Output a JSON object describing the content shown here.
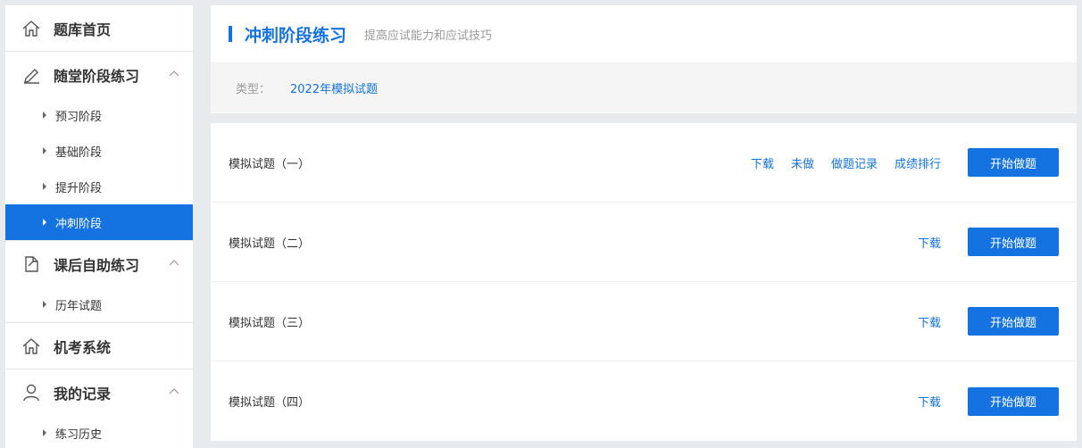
{
  "sidebar": {
    "home": {
      "label": "题库首页"
    },
    "practice": {
      "label": "随堂阶段练习",
      "items": [
        {
          "label": "预习阶段"
        },
        {
          "label": "基础阶段"
        },
        {
          "label": "提升阶段"
        },
        {
          "label": "冲刺阶段"
        }
      ]
    },
    "self_practice": {
      "label": "课后自助练习",
      "items": [
        {
          "label": "历年试题"
        }
      ]
    },
    "exam_system": {
      "label": "机考系统"
    },
    "records": {
      "label": "我的记录",
      "items": [
        {
          "label": "练习历史"
        }
      ]
    }
  },
  "header": {
    "title": "冲刺阶段练习",
    "subtitle": "提高应试能力和应试技巧",
    "type_label": "类型：",
    "type_value": "2022年模拟试题"
  },
  "exams": [
    {
      "title": "模拟试题（一）",
      "download": "下载",
      "undone": "未做",
      "record": "做题记录",
      "ranking": "成绩排行",
      "start": "开始做题"
    },
    {
      "title": "模拟试题（二）",
      "download": "下载",
      "start": "开始做题"
    },
    {
      "title": "模拟试题（三）",
      "download": "下载",
      "start": "开始做题"
    },
    {
      "title": "模拟试题（四）",
      "download": "下载",
      "start": "开始做题"
    }
  ],
  "colors": {
    "accent": "#1473e0",
    "background": "#e8ebee"
  }
}
